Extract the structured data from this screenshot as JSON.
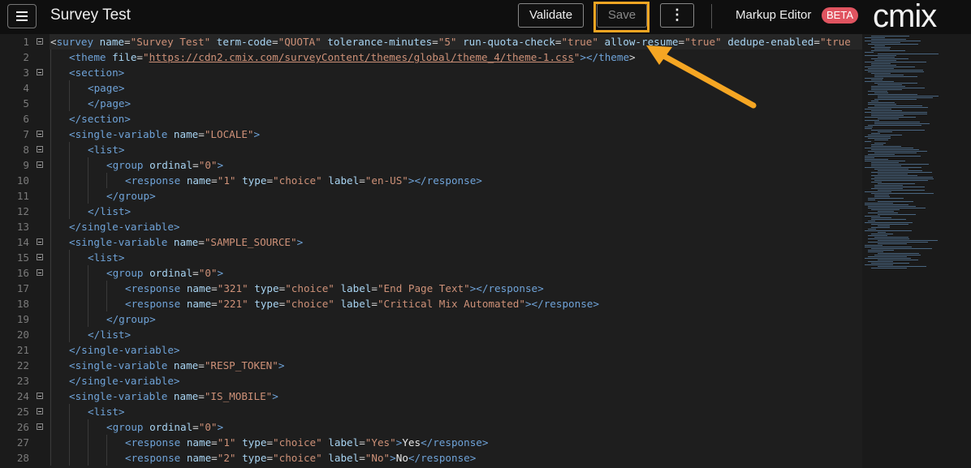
{
  "header": {
    "title": "Survey Test",
    "validate_label": "Validate",
    "save_label": "Save",
    "more_label": "⋮",
    "editor_label": "Markup Editor",
    "beta_badge": "BETA",
    "logo_text": "cmix"
  },
  "editor": {
    "lines": [
      {
        "n": "1",
        "indent": 0,
        "fold": true,
        "tokens": [
          [
            "b",
            "<"
          ],
          [
            "t",
            "survey "
          ],
          [
            "a",
            "name"
          ],
          [
            "b",
            "="
          ],
          [
            "v",
            "\"Survey Test\""
          ],
          [
            "a",
            " term-code"
          ],
          [
            "b",
            "="
          ],
          [
            "v",
            "\"QUOTA\""
          ],
          [
            "a",
            " tolerance-minutes"
          ],
          [
            "b",
            "="
          ],
          [
            "v",
            "\"5\""
          ],
          [
            "a",
            " run-quota-check"
          ],
          [
            "b",
            "="
          ],
          [
            "v",
            "\"true\""
          ],
          [
            "a",
            " allow-resume"
          ],
          [
            "b",
            "="
          ],
          [
            "v",
            "\"true\""
          ],
          [
            "a",
            " dedupe-enabled"
          ],
          [
            "b",
            "="
          ],
          [
            "v",
            "\"true"
          ]
        ]
      },
      {
        "n": "2",
        "indent": 1,
        "fold": false,
        "tokens": [
          [
            "t",
            "<theme "
          ],
          [
            "a",
            "file"
          ],
          [
            "b",
            "="
          ],
          [
            "v",
            "\""
          ],
          [
            "u",
            "https://cdn2.cmix.com/surveyContent/themes/global/theme_4/theme-1.css"
          ],
          [
            "v",
            "\""
          ],
          [
            "t",
            "></theme"
          ],
          [
            "b",
            ">"
          ]
        ]
      },
      {
        "n": "3",
        "indent": 1,
        "fold": true,
        "tokens": [
          [
            "t",
            "<section>"
          ]
        ]
      },
      {
        "n": "4",
        "indent": 2,
        "fold": false,
        "tokens": [
          [
            "t",
            "<page>"
          ]
        ]
      },
      {
        "n": "5",
        "indent": 2,
        "fold": false,
        "tokens": [
          [
            "t",
            "</page>"
          ]
        ]
      },
      {
        "n": "6",
        "indent": 1,
        "fold": false,
        "tokens": [
          [
            "t",
            "</section>"
          ]
        ]
      },
      {
        "n": "7",
        "indent": 1,
        "fold": true,
        "tokens": [
          [
            "t",
            "<single-variable "
          ],
          [
            "a",
            "name"
          ],
          [
            "b",
            "="
          ],
          [
            "v",
            "\"LOCALE\""
          ],
          [
            "t",
            ">"
          ]
        ]
      },
      {
        "n": "8",
        "indent": 2,
        "fold": true,
        "tokens": [
          [
            "t",
            "<list>"
          ]
        ]
      },
      {
        "n": "9",
        "indent": 3,
        "fold": true,
        "tokens": [
          [
            "t",
            "<group "
          ],
          [
            "a",
            "ordinal"
          ],
          [
            "b",
            "="
          ],
          [
            "v",
            "\"0\""
          ],
          [
            "t",
            ">"
          ]
        ]
      },
      {
        "n": "10",
        "indent": 4,
        "fold": false,
        "tokens": [
          [
            "t",
            "<response "
          ],
          [
            "a",
            "name"
          ],
          [
            "b",
            "="
          ],
          [
            "v",
            "\"1\""
          ],
          [
            "a",
            " type"
          ],
          [
            "b",
            "="
          ],
          [
            "v",
            "\"choice\""
          ],
          [
            "a",
            " label"
          ],
          [
            "b",
            "="
          ],
          [
            "v",
            "\"en-US\""
          ],
          [
            "t",
            "></response>"
          ]
        ]
      },
      {
        "n": "11",
        "indent": 3,
        "fold": false,
        "tokens": [
          [
            "t",
            "</group>"
          ]
        ]
      },
      {
        "n": "12",
        "indent": 2,
        "fold": false,
        "tokens": [
          [
            "t",
            "</list>"
          ]
        ]
      },
      {
        "n": "13",
        "indent": 1,
        "fold": false,
        "tokens": [
          [
            "t",
            "</single-variable>"
          ]
        ]
      },
      {
        "n": "14",
        "indent": 1,
        "fold": true,
        "tokens": [
          [
            "t",
            "<single-variable "
          ],
          [
            "a",
            "name"
          ],
          [
            "b",
            "="
          ],
          [
            "v",
            "\"SAMPLE_SOURCE\""
          ],
          [
            "t",
            ">"
          ]
        ]
      },
      {
        "n": "15",
        "indent": 2,
        "fold": true,
        "tokens": [
          [
            "t",
            "<list>"
          ]
        ]
      },
      {
        "n": "16",
        "indent": 3,
        "fold": true,
        "tokens": [
          [
            "t",
            "<group "
          ],
          [
            "a",
            "ordinal"
          ],
          [
            "b",
            "="
          ],
          [
            "v",
            "\"0\""
          ],
          [
            "t",
            ">"
          ]
        ]
      },
      {
        "n": "17",
        "indent": 4,
        "fold": false,
        "tokens": [
          [
            "t",
            "<response "
          ],
          [
            "a",
            "name"
          ],
          [
            "b",
            "="
          ],
          [
            "v",
            "\"321\""
          ],
          [
            "a",
            " type"
          ],
          [
            "b",
            "="
          ],
          [
            "v",
            "\"choice\""
          ],
          [
            "a",
            " label"
          ],
          [
            "b",
            "="
          ],
          [
            "v",
            "\"End Page Text\""
          ],
          [
            "t",
            "></response>"
          ]
        ]
      },
      {
        "n": "18",
        "indent": 4,
        "fold": false,
        "tokens": [
          [
            "t",
            "<response "
          ],
          [
            "a",
            "name"
          ],
          [
            "b",
            "="
          ],
          [
            "v",
            "\"221\""
          ],
          [
            "a",
            " type"
          ],
          [
            "b",
            "="
          ],
          [
            "v",
            "\"choice\""
          ],
          [
            "a",
            " label"
          ],
          [
            "b",
            "="
          ],
          [
            "v",
            "\"Critical Mix Automated\""
          ],
          [
            "t",
            "></response>"
          ]
        ]
      },
      {
        "n": "19",
        "indent": 3,
        "fold": false,
        "tokens": [
          [
            "t",
            "</group>"
          ]
        ]
      },
      {
        "n": "20",
        "indent": 2,
        "fold": false,
        "tokens": [
          [
            "t",
            "</list>"
          ]
        ]
      },
      {
        "n": "21",
        "indent": 1,
        "fold": false,
        "tokens": [
          [
            "t",
            "</single-variable>"
          ]
        ]
      },
      {
        "n": "22",
        "indent": 1,
        "fold": false,
        "tokens": [
          [
            "t",
            "<single-variable "
          ],
          [
            "a",
            "name"
          ],
          [
            "b",
            "="
          ],
          [
            "v",
            "\"RESP_TOKEN\""
          ],
          [
            "t",
            ">"
          ]
        ]
      },
      {
        "n": "23",
        "indent": 1,
        "fold": false,
        "tokens": [
          [
            "t",
            "</single-variable>"
          ]
        ]
      },
      {
        "n": "24",
        "indent": 1,
        "fold": true,
        "tokens": [
          [
            "t",
            "<single-variable "
          ],
          [
            "a",
            "name"
          ],
          [
            "b",
            "="
          ],
          [
            "v",
            "\"IS_MOBILE\""
          ],
          [
            "t",
            ">"
          ]
        ]
      },
      {
        "n": "25",
        "indent": 2,
        "fold": true,
        "tokens": [
          [
            "t",
            "<list>"
          ]
        ]
      },
      {
        "n": "26",
        "indent": 3,
        "fold": true,
        "tokens": [
          [
            "t",
            "<group "
          ],
          [
            "a",
            "ordinal"
          ],
          [
            "b",
            "="
          ],
          [
            "v",
            "\"0\""
          ],
          [
            "t",
            ">"
          ]
        ]
      },
      {
        "n": "27",
        "indent": 4,
        "fold": false,
        "tokens": [
          [
            "t",
            "<response "
          ],
          [
            "a",
            "name"
          ],
          [
            "b",
            "="
          ],
          [
            "v",
            "\"1\""
          ],
          [
            "a",
            " type"
          ],
          [
            "b",
            "="
          ],
          [
            "v",
            "\"choice\""
          ],
          [
            "a",
            " label"
          ],
          [
            "b",
            "="
          ],
          [
            "v",
            "\"Yes\""
          ],
          [
            "t",
            ">"
          ],
          [
            "x",
            "Yes"
          ],
          [
            "t",
            "</response>"
          ]
        ]
      },
      {
        "n": "28",
        "indent": 4,
        "fold": false,
        "tokens": [
          [
            "t",
            "<response "
          ],
          [
            "a",
            "name"
          ],
          [
            "b",
            "="
          ],
          [
            "v",
            "\"2\""
          ],
          [
            "a",
            " type"
          ],
          [
            "b",
            "="
          ],
          [
            "v",
            "\"choice\""
          ],
          [
            "a",
            " label"
          ],
          [
            "b",
            "="
          ],
          [
            "v",
            "\"No\""
          ],
          [
            "t",
            ">"
          ],
          [
            "x",
            "No"
          ],
          [
            "t",
            "</response>"
          ]
        ]
      }
    ]
  },
  "colors": {
    "accent_highlight": "#f5a623",
    "beta_badge": "#e05460",
    "tag": "#6fa3d8",
    "attribute": "#a8d4f2",
    "value": "#ce9178"
  }
}
